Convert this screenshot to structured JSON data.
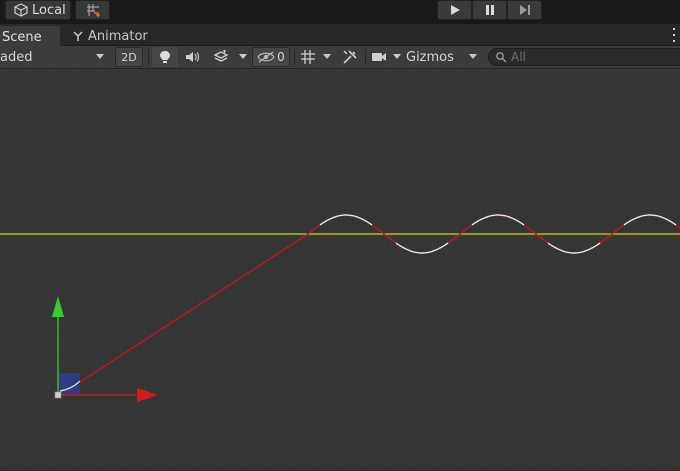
{
  "top_toolbar": {
    "pivot_label": "Local",
    "pivot_icon": "cube-icon",
    "snap_icon": "grid-snap-icon",
    "playback": [
      {
        "name": "play-button",
        "icon": "play-icon"
      },
      {
        "name": "pause-button",
        "icon": "pause-icon"
      },
      {
        "name": "step-button",
        "icon": "step-icon"
      }
    ]
  },
  "tabs": [
    {
      "label": "Scene",
      "active": true
    },
    {
      "label": "Animator",
      "icon": "animator-icon",
      "active": false
    }
  ],
  "scene_toolbar": {
    "draw_mode": "aded",
    "mode_2d": "2D",
    "hidden_count": "0",
    "gizmos_label": "Gizmos",
    "search_placeholder": "All"
  },
  "scene_view": {
    "colors": {
      "background": "#353535",
      "grid": "#3a3a3a",
      "yellow_line": "#d9d200",
      "trajectory": "#c01818",
      "wave_highlight": "#e6e6e6",
      "axis_x": "#d21c1c",
      "axis_y": "#3cc832",
      "plane_handle": "#2d3d8e"
    }
  }
}
